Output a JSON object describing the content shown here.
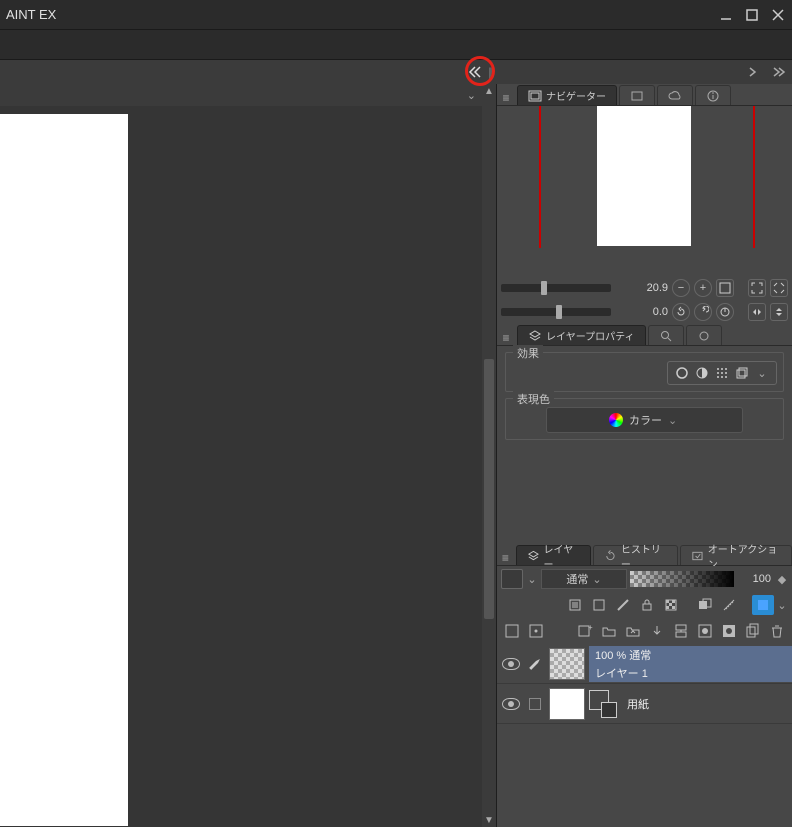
{
  "app": {
    "title": "AINT EX"
  },
  "navigator": {
    "tab_label": "ナビゲーター",
    "zoom_value": "20.9",
    "rotate_value": "0.0"
  },
  "layer_property": {
    "tab_label": "レイヤープロパティ",
    "effect_legend": "効果",
    "color_legend": "表現色",
    "color_mode": "カラー"
  },
  "layer_panel": {
    "tabs": {
      "layer": "レイヤー",
      "history": "ヒストリー",
      "auto_action": "オートアクション"
    },
    "blend_mode": "通常",
    "opacity": "100",
    "layers": [
      {
        "info": "100 % 通常",
        "name": "レイヤー 1"
      },
      {
        "name": "用紙"
      }
    ]
  }
}
